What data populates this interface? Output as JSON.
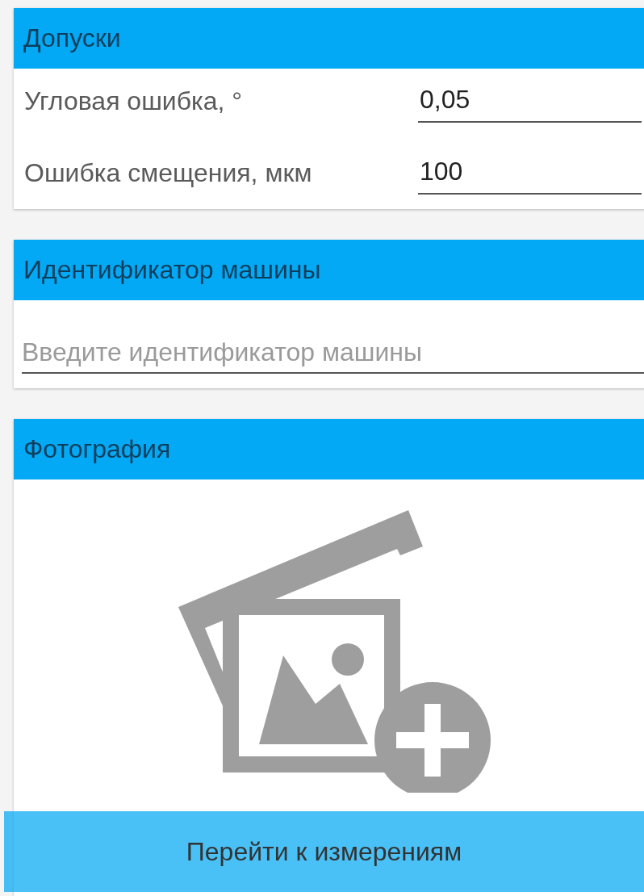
{
  "sections": [
    {
      "kind": "fields",
      "title": "Допуски",
      "fields": [
        {
          "label": "Угловая ошибка, °",
          "value": "0,05"
        },
        {
          "label": "Ошибка смещения, мкм",
          "value": "100"
        }
      ]
    },
    {
      "kind": "input",
      "title": "Идентификатор машины",
      "placeholder": "Введите идентификатор машины"
    },
    {
      "kind": "photo",
      "title": "Фотография"
    }
  ],
  "button": "Перейти к измерениям"
}
